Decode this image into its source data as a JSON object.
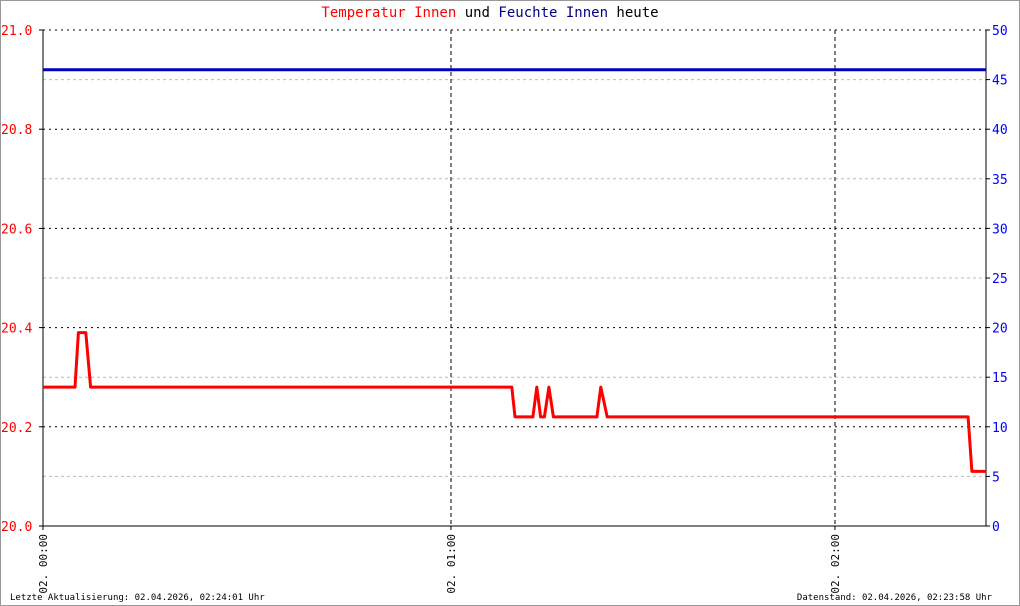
{
  "chart_data": {
    "type": "line",
    "title_parts": [
      {
        "text": "Temperatur Innen",
        "color": "#ff0000"
      },
      {
        "text": " und ",
        "color": "#000000"
      },
      {
        "text": "Feuchte Innen",
        "color": "#000080"
      },
      {
        "text": " heute",
        "color": "#000000"
      }
    ],
    "x_unit": "minutes since 02. 00:00",
    "x_ticks": [
      {
        "label": "02. 00:00",
        "value": 0
      },
      {
        "label": "02. 01:00",
        "value": 60
      },
      {
        "label": "02. 02:00",
        "value": 120
      }
    ],
    "xlim": [
      0,
      143.6
    ],
    "y_left": {
      "label": "Temperatur Innen",
      "color": "#ff0000",
      "range": [
        20.0,
        21.0
      ],
      "ticks": [
        "20.0",
        "20.2",
        "20.4",
        "20.6",
        "20.8",
        "21.0"
      ]
    },
    "y_right": {
      "label": "Feuchte Innen",
      "color": "#0000ff",
      "range": [
        0,
        50
      ],
      "ticks": [
        "0",
        "5",
        "10",
        "15",
        "20",
        "25",
        "30",
        "35",
        "40",
        "45",
        "50"
      ]
    },
    "series": [
      {
        "name": "Temperatur Innen",
        "axis": "left",
        "color": "#ff0000",
        "x": [
          0,
          4.7,
          5.2,
          6.3,
          7.0,
          69.5,
          70.0,
          72.8,
          73.4,
          74.0,
          74.6,
          75.3,
          76.0,
          82.8,
          83.4,
          84.4,
          140.8,
          141.4,
          143.6
        ],
        "y": [
          20.28,
          20.28,
          20.39,
          20.39,
          20.28,
          20.28,
          20.22,
          20.22,
          20.28,
          20.22,
          20.22,
          20.28,
          20.22,
          20.22,
          20.28,
          20.22,
          20.22,
          20.11,
          20.11
        ]
      },
      {
        "name": "Feuchte Innen",
        "axis": "right",
        "color": "#0000c0",
        "x": [
          0,
          143.6
        ],
        "y": [
          46,
          46
        ]
      }
    ]
  },
  "footer": {
    "left": "Letzte Aktualisierung: 02.04.2026, 02:24:01 Uhr",
    "right": "Datenstand: 02.04.2026, 02:23:58 Uhr"
  }
}
